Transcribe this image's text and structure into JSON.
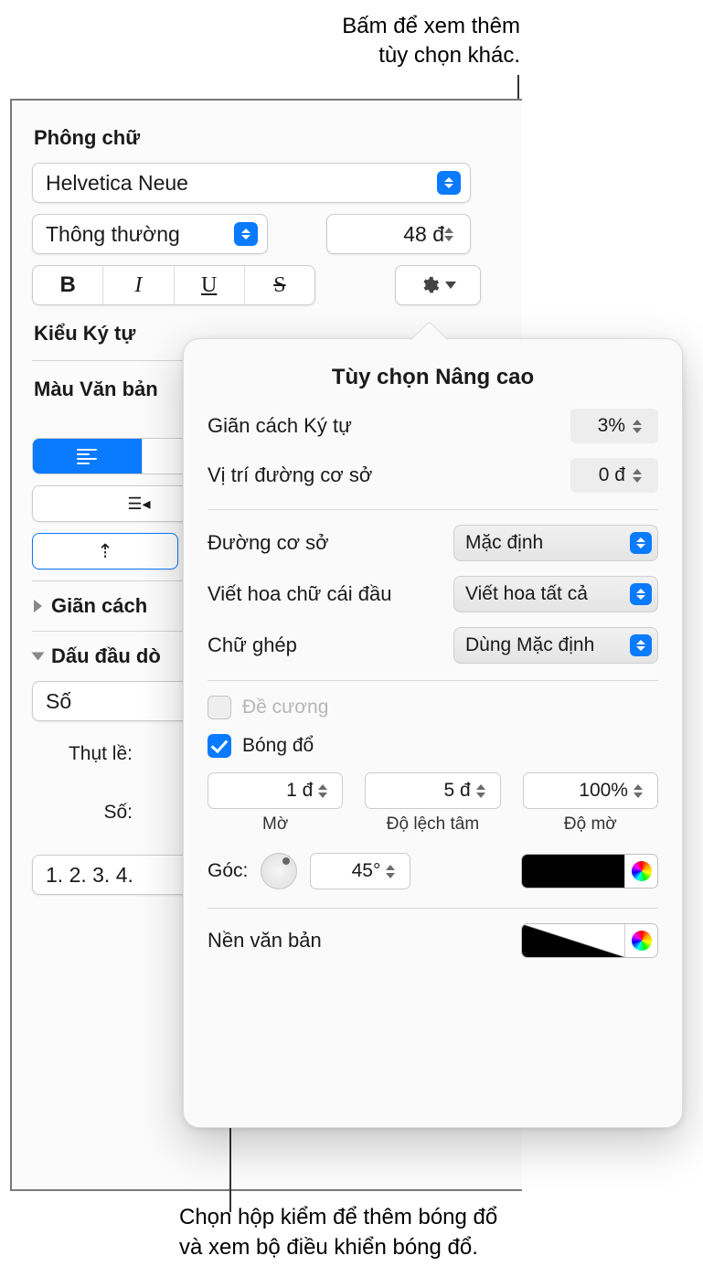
{
  "callouts": {
    "top": "Bấm để xem thêm\ntùy chọn khác.",
    "bottom": "Chọn hộp kiểm để thêm bóng đổ\nvà xem bộ điều khiển bóng đổ."
  },
  "font": {
    "section": "Phông chữ",
    "family": "Helvetica Neue",
    "style": "Thông thường",
    "size": "48 đ",
    "bold": "B",
    "italic": "I",
    "underline": "U",
    "strike": "S"
  },
  "charStyle": "Kiểu Ký tự",
  "textColor": "Màu Văn bản",
  "spacing": "Giãn cách",
  "bullets": {
    "title": "Dấu đầu dò",
    "type": "Số",
    "indent_label": "Thụt lề:",
    "number_label": "Số:",
    "format": "1. 2. 3. 4."
  },
  "popover": {
    "title": "Tùy chọn Nâng cao",
    "charSpacing_label": "Giãn cách Ký tự",
    "charSpacing_value": "3%",
    "baselinePos_label": "Vị trí đường cơ sở",
    "baselinePos_value": "0 đ",
    "baseline_label": "Đường cơ sở",
    "baseline_value": "Mặc định",
    "caps_label": "Viết hoa chữ cái đầu",
    "caps_value": "Viết hoa tất cả",
    "lig_label": "Chữ ghép",
    "lig_value": "Dùng Mặc định",
    "outline": "Đề cương",
    "shadow": "Bóng đổ",
    "blur_val": "1 đ",
    "blur_lbl": "Mờ",
    "offset_val": "5 đ",
    "offset_lbl": "Độ lệch tâm",
    "opacity_val": "100%",
    "opacity_lbl": "Độ mờ",
    "angle_lbl": "Góc:",
    "angle_val": "45°",
    "textbg": "Nền văn bản"
  }
}
